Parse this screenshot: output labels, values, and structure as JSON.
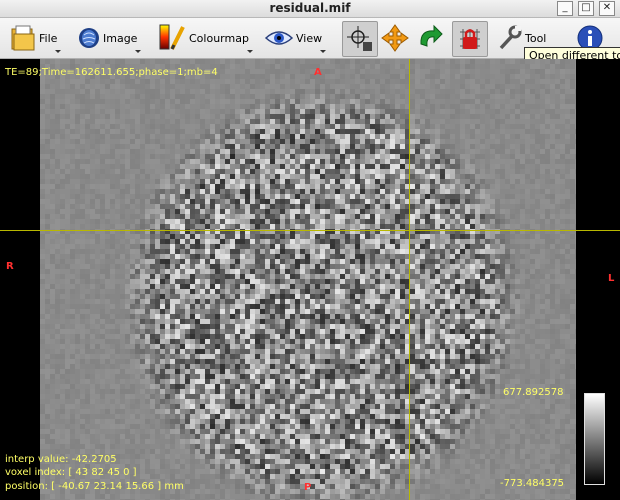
{
  "window": {
    "title": "residual.mif",
    "minimize": "_",
    "maximize": "□",
    "close": "✕"
  },
  "toolbar": {
    "file": "File",
    "image": "Image",
    "colourmap": "Colourmap",
    "view": "View",
    "tool": "Tool",
    "tooltip": "Open different tool"
  },
  "overlay": {
    "header": "TE=89;Time=162611.655;phase=1;mb=4",
    "interp": "interp value: -42.2705",
    "voxel": "voxel index: [ 43 82 45 0 ]",
    "position": "position: [ -40.67 23.14 15.66 ] mm"
  },
  "orientation": {
    "top": "A",
    "bottom": "P",
    "left": "R",
    "right": "L"
  },
  "colourbar": {
    "max": "677.892578",
    "min": "-773.484375"
  },
  "colors": {
    "crosshair": "#c8c800",
    "overlay_text": "#ffff66",
    "orientation_text": "#ff3030",
    "background": "#8a8a8a"
  }
}
